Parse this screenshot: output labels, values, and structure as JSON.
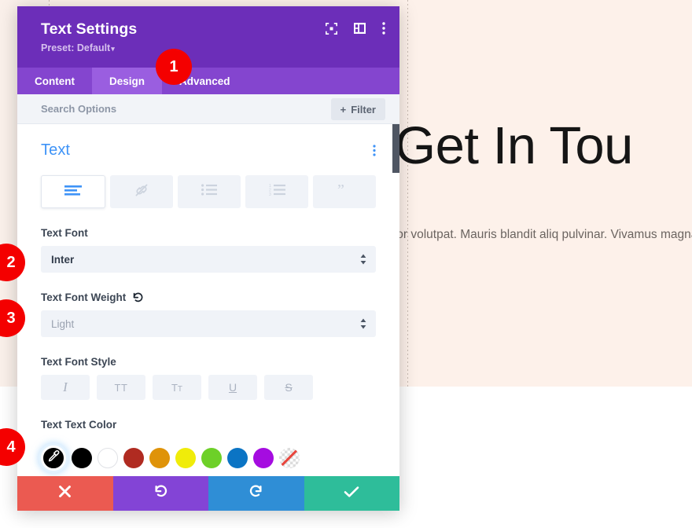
{
  "preview": {
    "heading": "Get In Tou",
    "body": "cipit tortor eget felis porttitor volutpat. Mauris blandit aliq pulvinar. Vivamus magna justo, lacinia eget consect",
    "background_color": "#fdf1ea"
  },
  "modal": {
    "title": "Text Settings",
    "preset_label": "Preset: Default",
    "preset_caret": "▾",
    "header_color": "#6c2eb9",
    "header_icons": [
      {
        "name": "fullscreen-icon",
        "label": "Fullscreen"
      },
      {
        "name": "layout-panel-icon",
        "label": "Change Layout"
      },
      {
        "name": "more-vertical-icon",
        "label": "More Options"
      }
    ],
    "tabs": [
      {
        "label": "Content",
        "active": false
      },
      {
        "label": "Design",
        "active": true
      },
      {
        "label": "Advanced",
        "active": false
      }
    ],
    "search": {
      "placeholder": "Search Options",
      "value": "",
      "filter_label": "Filter",
      "filter_plus": "+"
    },
    "section": {
      "title": "Text",
      "menu_icon": "more-vertical-icon"
    },
    "toggle_row": [
      {
        "name": "paragraph-text-toggle",
        "icon": "align-left-icon",
        "active": true
      },
      {
        "name": "link-toggle",
        "icon": "link-icon",
        "active": false
      },
      {
        "name": "unordered-list-toggle",
        "icon": "bullet-list-icon",
        "active": false
      },
      {
        "name": "ordered-list-toggle",
        "icon": "numbered-list-icon",
        "active": false
      },
      {
        "name": "blockquote-toggle",
        "icon": "quote-icon",
        "active": false
      }
    ],
    "fields": {
      "text_font": {
        "label": "Text Font",
        "value": "Inter",
        "muted": false
      },
      "text_font_weight": {
        "label": "Text Font Weight",
        "value": "Light",
        "muted": true,
        "reset_icon": "reset-undo-icon"
      },
      "text_font_style": {
        "label": "Text Font Style",
        "buttons": [
          {
            "name": "italic-button",
            "glyph": "I",
            "type": "i"
          },
          {
            "name": "uppercase-button",
            "glyph": "TT",
            "type": "tt"
          },
          {
            "name": "capitalize-button",
            "glyph": "T",
            "glyph2": "T",
            "type": "tc"
          },
          {
            "name": "underline-button",
            "glyph": "U",
            "type": "u"
          },
          {
            "name": "strikethrough-button",
            "glyph": "S",
            "type": "s"
          }
        ]
      },
      "text_text_color": {
        "label": "Text Text Color",
        "selected_swatch": {
          "name": "eyedropper-swatch",
          "icon": "eyedropper-icon",
          "color": "#000000"
        },
        "swatches": [
          {
            "name": "swatch-black",
            "color": "#000000"
          },
          {
            "name": "swatch-white",
            "color": "#ffffff"
          },
          {
            "name": "swatch-brick-red",
            "color": "#b02b21"
          },
          {
            "name": "swatch-orange",
            "color": "#df9309"
          },
          {
            "name": "swatch-yellow",
            "color": "#f0ec0a"
          },
          {
            "name": "swatch-green",
            "color": "#6dd028"
          },
          {
            "name": "swatch-blue",
            "color": "#0b74c4"
          },
          {
            "name": "swatch-violet",
            "color": "#a50ce0"
          },
          {
            "name": "swatch-transparent",
            "color": "transparent"
          }
        ]
      }
    },
    "footer": [
      {
        "name": "cancel-button",
        "icon": "close-x-icon",
        "color": "#eb5a51"
      },
      {
        "name": "undo-button",
        "icon": "undo-icon",
        "color": "#8344d6"
      },
      {
        "name": "redo-button",
        "icon": "redo-icon",
        "color": "#2f8ed6"
      },
      {
        "name": "save-button",
        "icon": "checkmark-icon",
        "color": "#2ebd9a"
      }
    ]
  },
  "step_badges": [
    {
      "number": "1"
    },
    {
      "number": "2"
    },
    {
      "number": "3"
    },
    {
      "number": "4"
    }
  ]
}
